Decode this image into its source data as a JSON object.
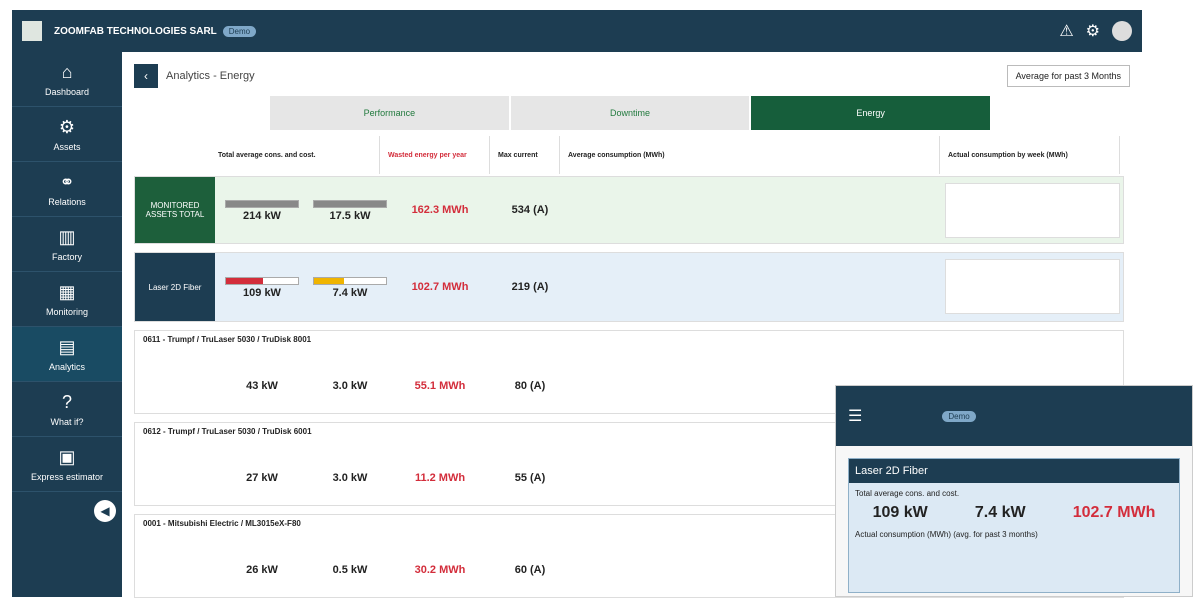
{
  "app": {
    "company": "ZOOMFAB TECHNOLOGIES SARL",
    "demo": "Demo",
    "page_title": "Analytics - Energy",
    "period": "Average for past 3 Months"
  },
  "sidebar": [
    "Dashboard",
    "Assets",
    "Relations",
    "Factory",
    "Monitoring",
    "Analytics",
    "What if?",
    "Express estimator"
  ],
  "tabs": [
    "Performance",
    "Downtime",
    "Energy"
  ],
  "headers": [
    "Total average cons. and cost.",
    "Wasted energy per year",
    "Max current",
    "Average consumption (MWh)",
    "Actual consumption by week (MWh)"
  ],
  "rows": [
    {
      "name": "MONITORED ASSETS TOTAL",
      "a": "214 kW",
      "b": "17.5 kW",
      "waste": "162.3 MWh",
      "current": "534 (A)"
    },
    {
      "name": "Laser 2D Fiber",
      "a": "109 kW",
      "b": "7.4 kW",
      "waste": "102.7 MWh",
      "current": "219 (A)"
    },
    {
      "name": "0611 - Trumpf / TruLaser 5030 / TruDisk 8001",
      "a": "43 kW",
      "b": "3.0 kW",
      "waste": "55.1 MWh",
      "current": "80 (A)"
    },
    {
      "name": "0612 - Trumpf / TruLaser 5030 / TruDisk 6001",
      "a": "27 kW",
      "b": "3.0 kW",
      "waste": "11.2 MWh",
      "current": "55 (A)"
    },
    {
      "name": "0001 - Mitsubishi Electric / ML3015eX-F80",
      "a": "26 kW",
      "b": "0.5 kW",
      "waste": "30.2 MWh",
      "current": "60 (A)"
    }
  ],
  "mobile": {
    "demo": "Demo",
    "title": "Laser 2D Fiber",
    "summary": "Total average cons. and cost.",
    "waste": "Wasted energy per year",
    "avg": "Actual consumption (MWh) (avg. for past 3 months)",
    "v1": "109 kW",
    "v2": "7.4 kW",
    "v3": "102.7 MWh"
  }
}
